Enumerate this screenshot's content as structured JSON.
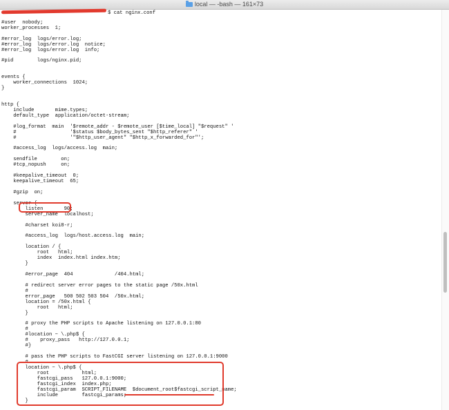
{
  "window": {
    "title": "local — -bash — 161×73",
    "folder_icon": "folder-icon"
  },
  "terminal": {
    "prompt_command": "$ cat nginx.conf",
    "lines": [
      "",
      "#user  nobody;",
      "worker_processes  1;",
      "",
      "#error_log  logs/error.log;",
      "#error_log  logs/error.log  notice;",
      "#error_log  logs/error.log  info;",
      "",
      "#pid        logs/nginx.pid;",
      "",
      "",
      "events {",
      "    worker_connections  1024;",
      "}",
      "",
      "",
      "http {",
      "    include       mime.types;",
      "    default_type  application/octet-stream;",
      "",
      "    #log_format  main  '$remote_addr - $remote_user [$time_local] \"$request\" '",
      "    #                  '$status $body_bytes_sent \"$http_referer\" '",
      "    #                  '\"$http_user_agent\" \"$http_x_forwarded_for\"';",
      "",
      "    #access_log  logs/access.log  main;",
      "",
      "    sendfile        on;",
      "    #tcp_nopush     on;",
      "",
      "    #keepalive_timeout  0;",
      "    keepalive_timeout  65;",
      "",
      "    #gzip  on;",
      "",
      "    server {",
      "        listen       90;",
      "        server_name  localhost;",
      "",
      "        #charset koi8-r;",
      "",
      "        #access_log  logs/host.access.log  main;",
      "",
      "        location / {",
      "            root   html;",
      "            index  index.html index.htm;",
      "        }",
      "",
      "        #error_page  404              /404.html;",
      "",
      "        # redirect server error pages to the static page /50x.html",
      "        #",
      "        error_page   500 502 503 504  /50x.html;",
      "        location = /50x.html {",
      "            root   html;",
      "        }",
      "",
      "        # proxy the PHP scripts to Apache listening on 127.0.0.1:80",
      "        #",
      "        #location ~ \\.php$ {",
      "        #    proxy_pass   http://127.0.0.1;",
      "        #}",
      "",
      "        # pass the PHP scripts to FastCGI server listening on 127.0.0.1:9000",
      "        #",
      "        location ~ \\.php$ {",
      "            root           html;",
      "            fastcgi_pass   127.0.0.1:9000;",
      "            fastcgi_index  index.php;",
      "            fastcgi_param  SCRIPT_FILENAME  $document_root$fastcgi_script_name;",
      "            include        fastcgi_params;",
      "        }"
    ]
  },
  "annotations": {
    "highlight_color": "#e0392b",
    "redaction_color": "#e23a2e"
  }
}
